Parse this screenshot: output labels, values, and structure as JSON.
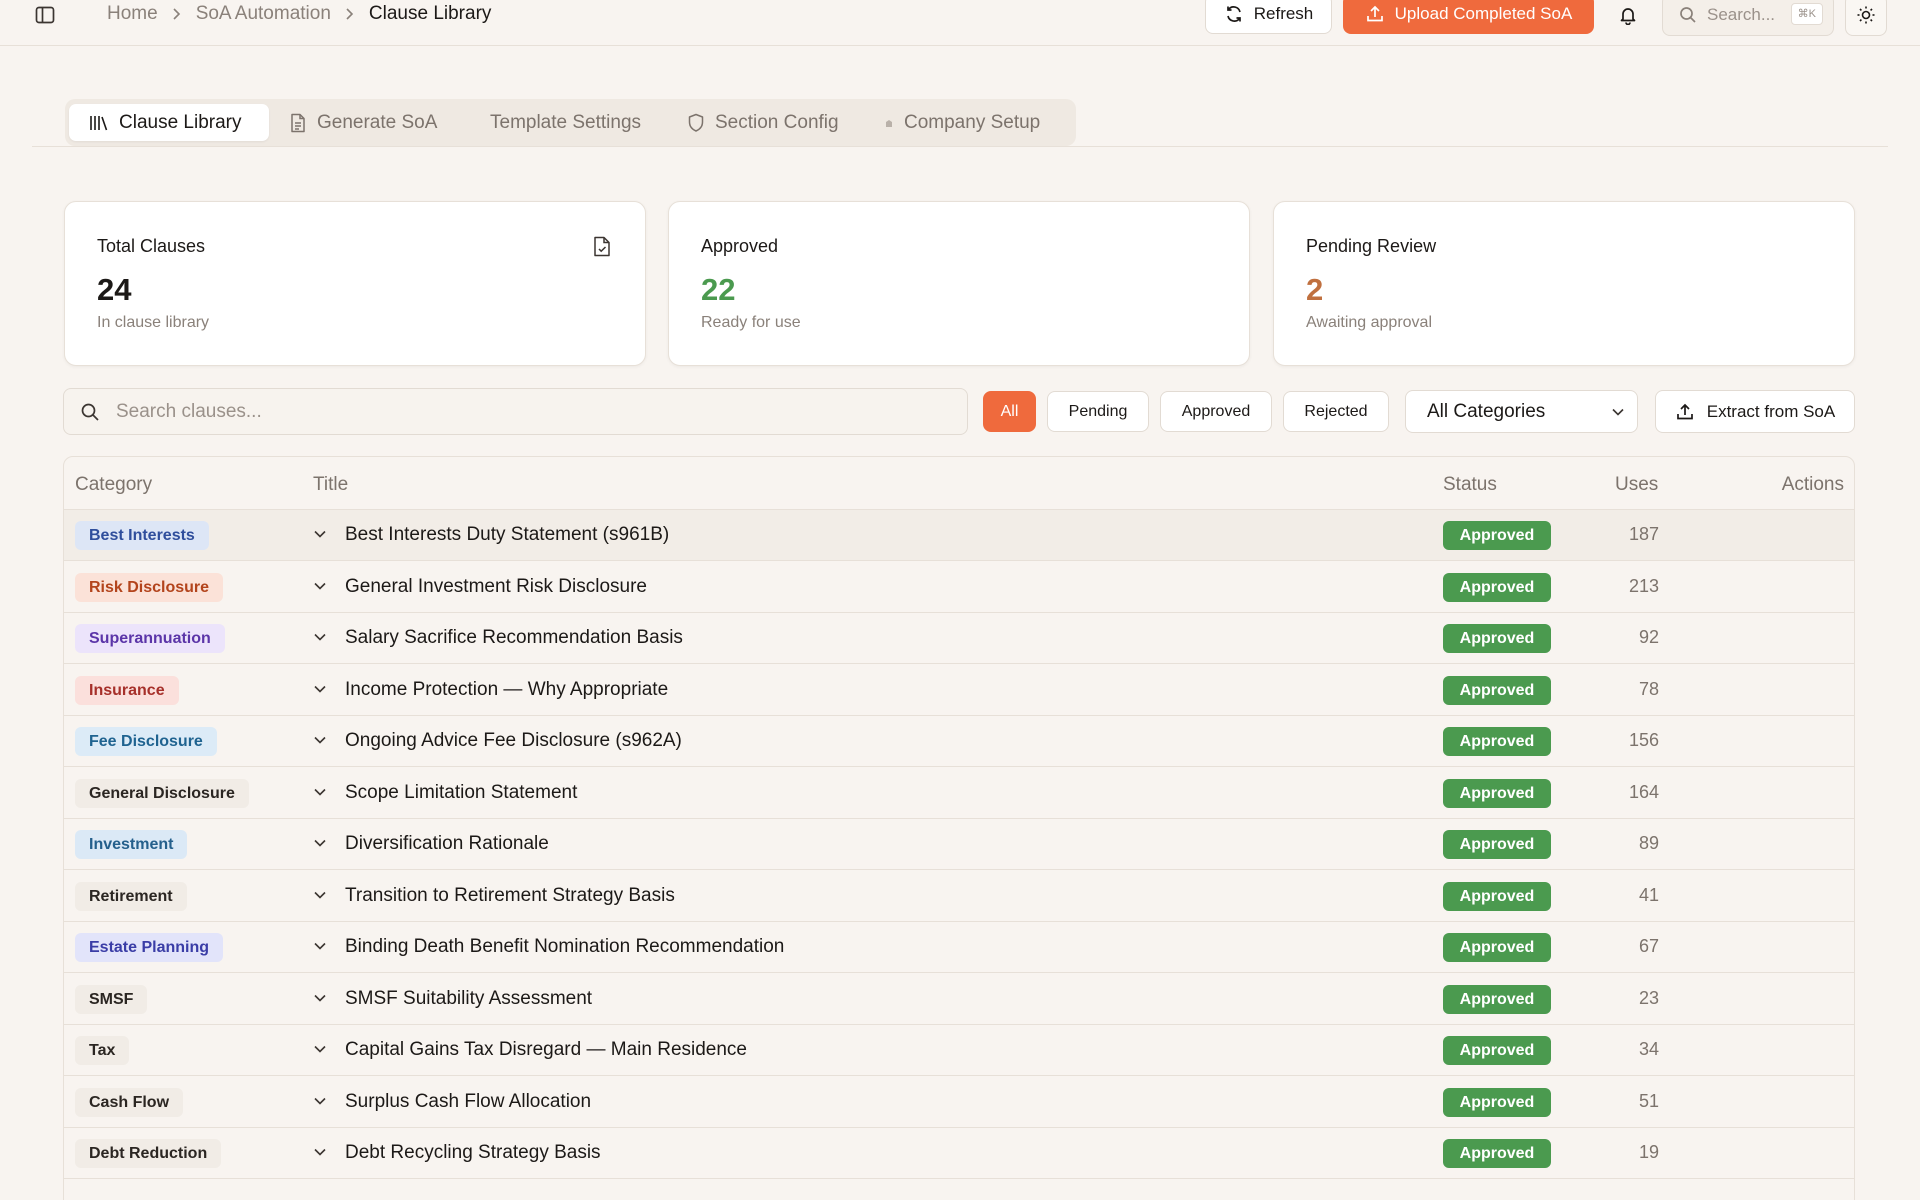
{
  "breadcrumb": [
    "Home",
    "SoA Automation",
    "Clause Library"
  ],
  "topbar": {
    "refresh_label": "Refresh",
    "upload_label": "Upload Completed SoA",
    "search_placeholder": "Search...",
    "search_shortcut": "⌘K"
  },
  "tabs": [
    {
      "label": "Clause Library",
      "icon": "library-icon",
      "active": true
    },
    {
      "label": "Generate SoA",
      "icon": "document-icon",
      "active": false
    },
    {
      "label": "Template Settings",
      "icon": "",
      "active": false
    },
    {
      "label": "Section Config",
      "icon": "shield-icon",
      "active": false
    },
    {
      "label": "Company Setup",
      "icon": "building-icon",
      "active": false
    }
  ],
  "stats": {
    "total": {
      "label": "Total Clauses",
      "value": "24",
      "sub": "In clause library"
    },
    "approved": {
      "label": "Approved",
      "value": "22",
      "sub": "Ready for use"
    },
    "pending": {
      "label": "Pending Review",
      "value": "2",
      "sub": "Awaiting approval"
    }
  },
  "filters": {
    "search_placeholder": "Search clauses...",
    "status_chips": [
      "All",
      "Pending",
      "Approved",
      "Rejected"
    ],
    "active_chip": "All",
    "category_selected": "All Categories",
    "extract_label": "Extract from SoA"
  },
  "table": {
    "columns": {
      "category": "Category",
      "title": "Title",
      "status": "Status",
      "uses": "Uses",
      "actions": "Actions"
    },
    "rows": [
      {
        "category": "Best Interests",
        "title": "Best Interests Duty Statement (s961B)",
        "status": "Approved",
        "uses": "187"
      },
      {
        "category": "Risk Disclosure",
        "title": "General Investment Risk Disclosure",
        "status": "Approved",
        "uses": "213"
      },
      {
        "category": "Superannuation",
        "title": "Salary Sacrifice Recommendation Basis",
        "status": "Approved",
        "uses": "92"
      },
      {
        "category": "Insurance",
        "title": "Income Protection — Why Appropriate",
        "status": "Approved",
        "uses": "78"
      },
      {
        "category": "Fee Disclosure",
        "title": "Ongoing Advice Fee Disclosure (s962A)",
        "status": "Approved",
        "uses": "156"
      },
      {
        "category": "General Disclosure",
        "title": "Scope Limitation Statement",
        "status": "Approved",
        "uses": "164"
      },
      {
        "category": "Investment",
        "title": "Diversification Rationale",
        "status": "Approved",
        "uses": "89"
      },
      {
        "category": "Retirement",
        "title": "Transition to Retirement Strategy Basis",
        "status": "Approved",
        "uses": "41"
      },
      {
        "category": "Estate Planning",
        "title": "Binding Death Benefit Nomination Recommendation",
        "status": "Approved",
        "uses": "67"
      },
      {
        "category": "SMSF",
        "title": "SMSF Suitability Assessment",
        "status": "Approved",
        "uses": "23"
      },
      {
        "category": "Tax",
        "title": "Capital Gains Tax Disregard — Main Residence",
        "status": "Approved",
        "uses": "34"
      },
      {
        "category": "Cash Flow",
        "title": "Surplus Cash Flow Allocation",
        "status": "Approved",
        "uses": "51"
      },
      {
        "category": "Debt Reduction",
        "title": "Debt Recycling Strategy Basis",
        "status": "Approved",
        "uses": "19"
      }
    ]
  },
  "colors": {
    "accent": "#ef6a3d",
    "approved_green": "#4b9a4f",
    "pending_orange": "#c0703f",
    "background": "#f8f4f0",
    "category_badges": {
      "Best Interests": {
        "bg": "#dde6f6",
        "fg": "#2f4e9c"
      },
      "Risk Disclosure": {
        "bg": "#fbe2d8",
        "fg": "#b3441c"
      },
      "Superannuation": {
        "bg": "#ece4fb",
        "fg": "#5b35a8"
      },
      "Insurance": {
        "bg": "#fbe0dc",
        "fg": "#a6302a"
      },
      "Fee Disclosure": {
        "bg": "#dcebf7",
        "fg": "#1f6390"
      },
      "General Disclosure": {
        "bg": "#f1ece6",
        "fg": "#2b2622"
      },
      "Investment": {
        "bg": "#dbe9f6",
        "fg": "#25608c"
      },
      "Retirement": {
        "bg": "#f1ece6",
        "fg": "#2b2622"
      },
      "Estate Planning": {
        "bg": "#e2e4fa",
        "fg": "#3a3da6"
      },
      "SMSF": {
        "bg": "#f1ece6",
        "fg": "#2b2622"
      },
      "Tax": {
        "bg": "#f1ece6",
        "fg": "#2b2622"
      },
      "Cash Flow": {
        "bg": "#f1ece6",
        "fg": "#2b2622"
      },
      "Debt Reduction": {
        "bg": "#f1ece6",
        "fg": "#2b2622"
      }
    }
  }
}
